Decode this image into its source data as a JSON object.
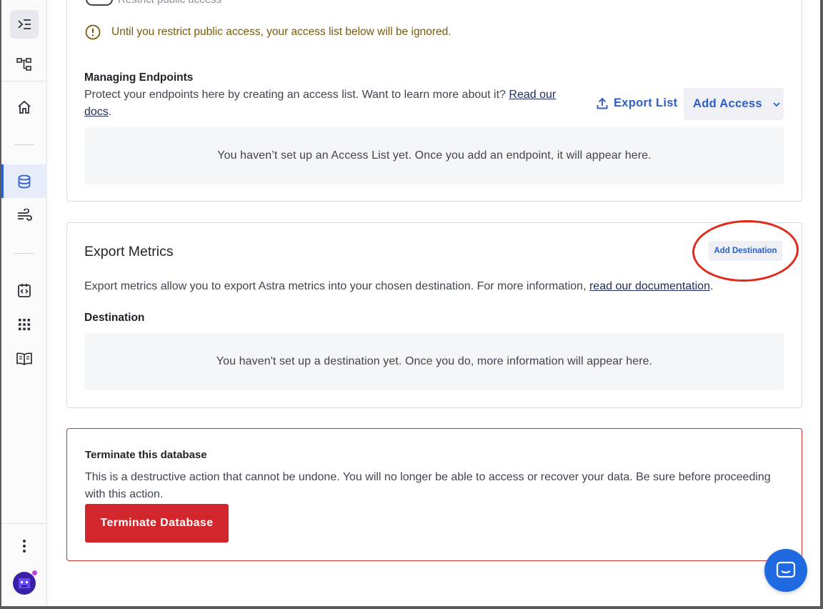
{
  "sidebar": {
    "icons": [
      "collapse-menu-icon",
      "org-tree-icon",
      "home-icon",
      "database-icon",
      "streaming-icon",
      "api-icon",
      "apps-grid-icon",
      "docs-book-icon",
      "more-vertical-icon"
    ]
  },
  "access": {
    "restrict_label": "Restrict public access",
    "warning": "Until you restrict public access, your access list below will be ignored.",
    "managing_title": "Managing Endpoints",
    "managing_desc": "Protect your endpoints here by creating an access list. Want to learn more about it?",
    "docs_link_line1": "Read our",
    "docs_link_line2": "docs",
    "docs_period": ".",
    "export_list": "Export List",
    "add_access": "Add Access",
    "empty_message": "You haven’t set up an Access List yet. Once you add an endpoint, it will appear here."
  },
  "metrics": {
    "title": "Export Metrics",
    "add_destination": "Add Destination",
    "description": "Export metrics allow you to export Astra metrics into your chosen destination. For more information,",
    "doc_link": "read our documentation",
    "doc_period": ".",
    "destination_label": "Destination",
    "empty_message": "You haven't set up a destination yet. Once you do, more information will appear here."
  },
  "danger": {
    "title": "Terminate this database",
    "description": "This is a destructive action that cannot be undone. You will no longer be able to access or recover your data. Be sure before proceeding with this action.",
    "button": "Terminate Database"
  },
  "colors": {
    "accent": "#2a5fc9",
    "danger": "#d1262b",
    "warning": "#7a5a0a",
    "annotation": "#e02a1c"
  }
}
